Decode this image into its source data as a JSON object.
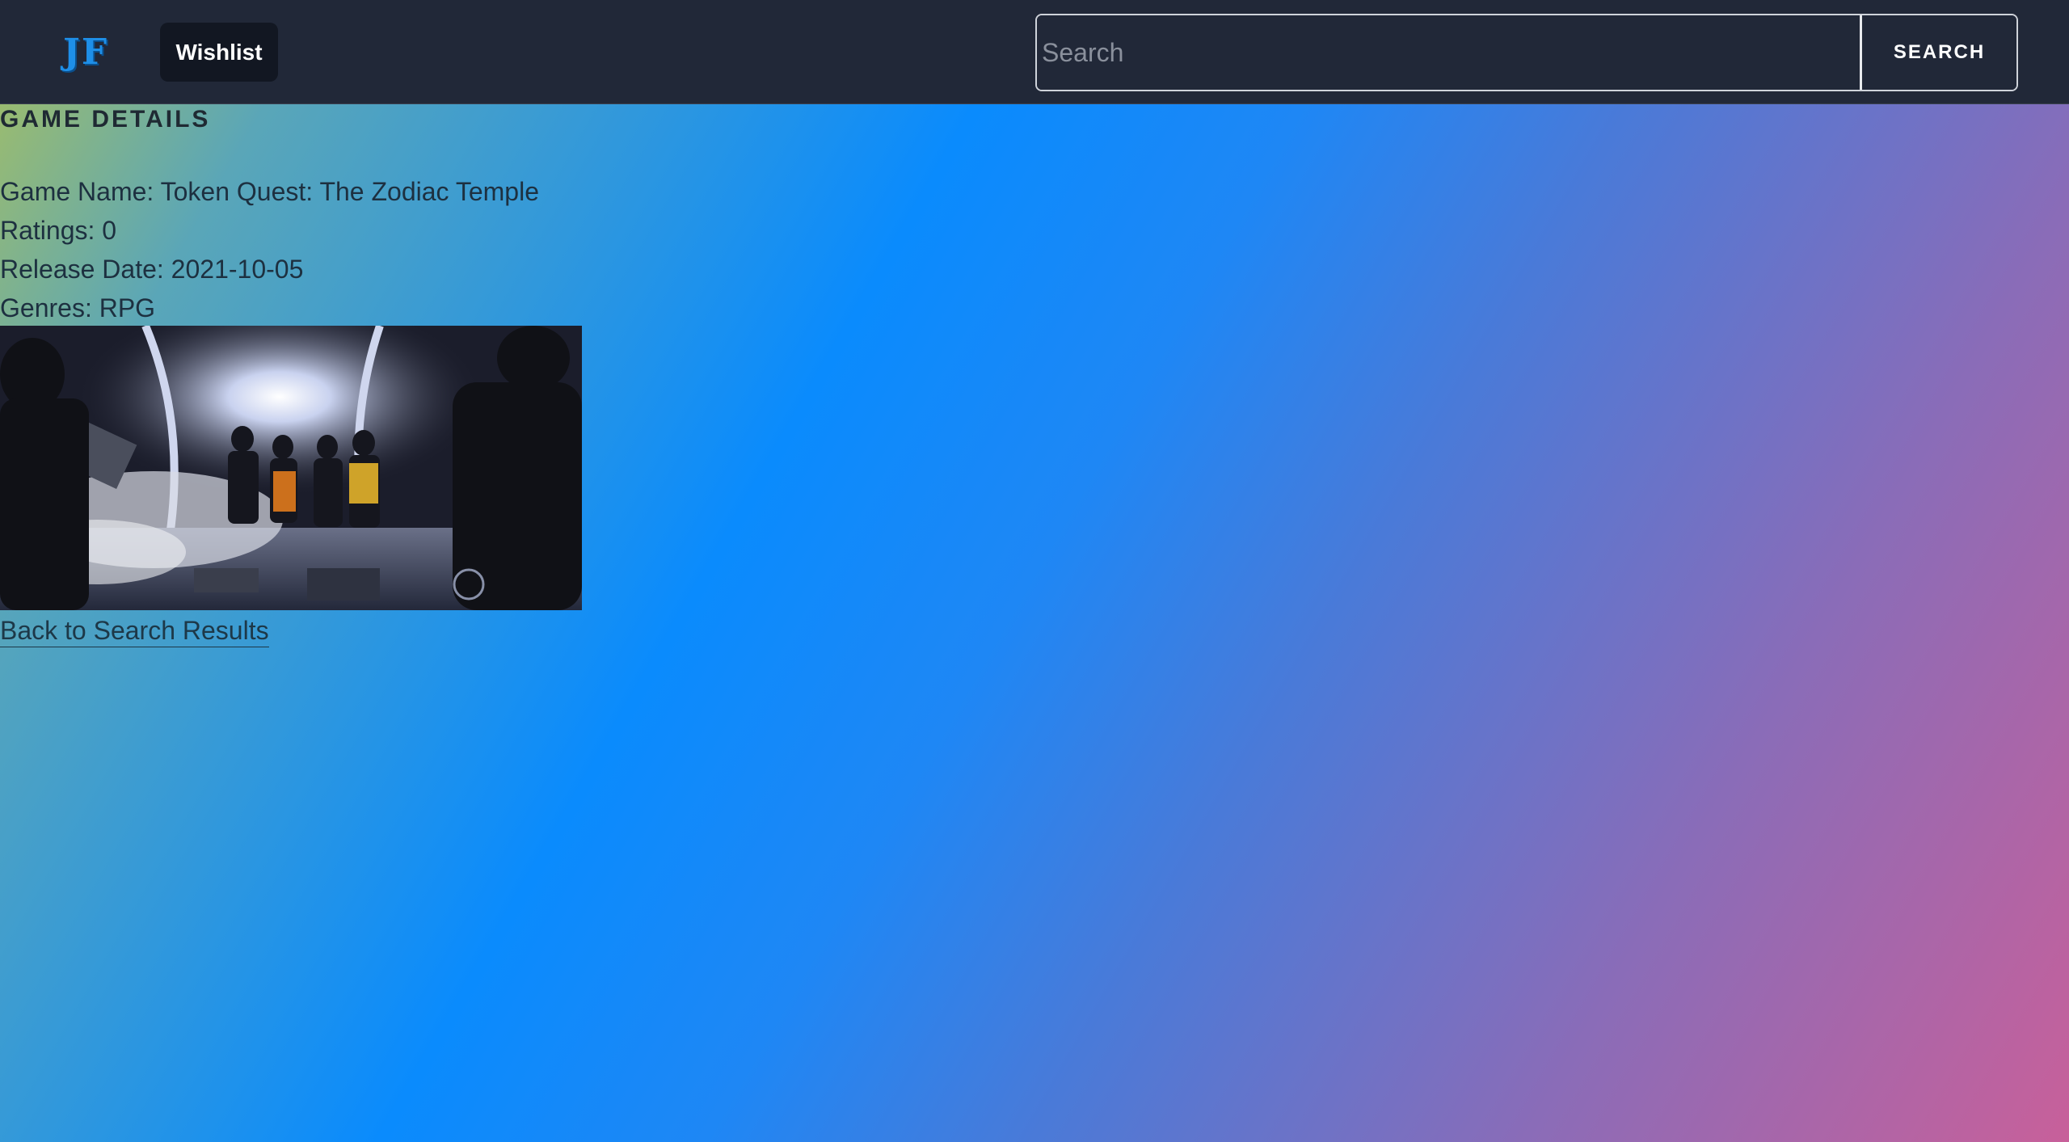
{
  "navbar": {
    "logo_text": "JF",
    "wishlist_label": "Wishlist",
    "search_placeholder": "Search",
    "search_value": "",
    "search_button_label": "SEARCH"
  },
  "game": {
    "heading": "GAME DETAILS",
    "name_line": "Game Name: Token Quest: The Zodiac Temple",
    "ratings_line": "Ratings: 0",
    "release_line": "Release Date: 2021-10-05",
    "genres_line": "Genres: RPG",
    "back_link_label": "Back to Search Results"
  },
  "colors": {
    "navbar_bg": "#212838",
    "logo": "#1e8fe8",
    "wishlist_bg": "#121722",
    "gradient_start": "#a8c060",
    "gradient_mid": "#0a8bfd",
    "gradient_end": "#c8609a"
  }
}
